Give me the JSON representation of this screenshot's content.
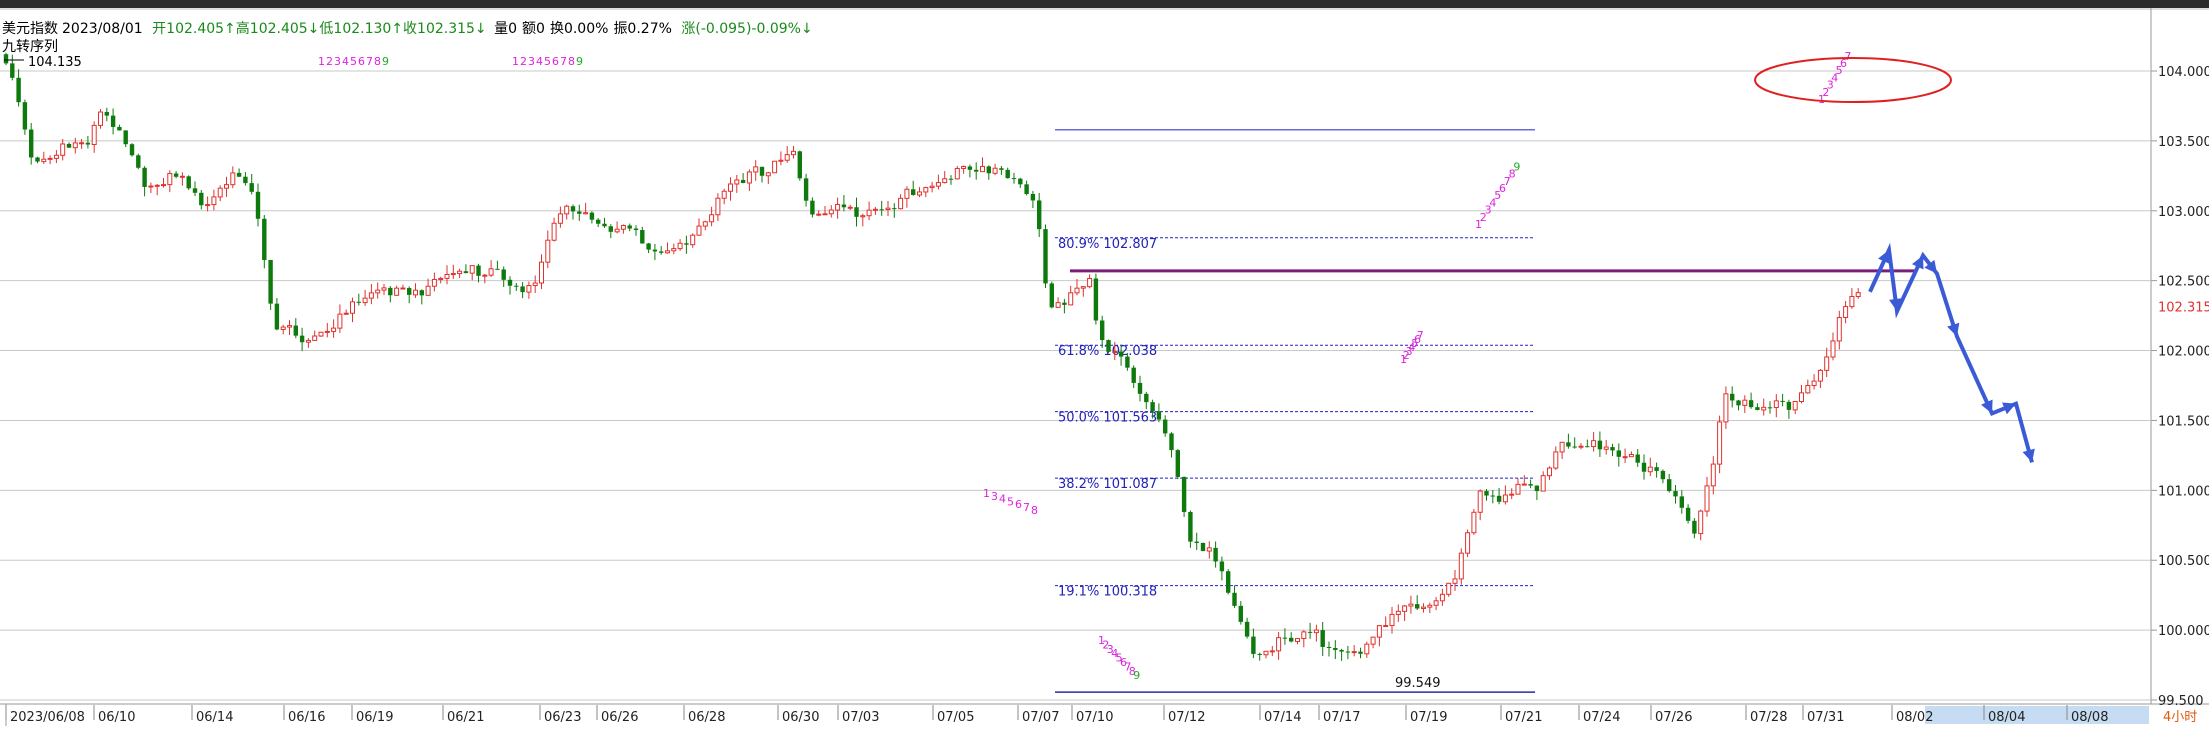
{
  "header": {
    "name": "美元指数",
    "date": "2023/08/01",
    "open": "开102.405↑",
    "high": "高102.405↓",
    "low": "低102.130↑",
    "close": "收102.315↓",
    "volume": "量0",
    "amount": "额0",
    "turnover": "换0.00%",
    "amplitude": "振0.27%",
    "change": "涨(-0.095)-0.09%↓"
  },
  "indicator": {
    "name": "九转序列",
    "max_value": "104.135"
  },
  "colors": {
    "up": "#e0322e",
    "down": "#0e7a0e",
    "fib": "#2222cc",
    "resistance": "#7a1e7a",
    "magenta": "#dd22dd",
    "green_num": "#22aa22",
    "arrow": "#3b5bd6",
    "ellipse": "#e02020",
    "grid": "#c8c8c8",
    "price_label": "#e0322e"
  },
  "chart_data": {
    "type": "candlestick",
    "title": "美元指数",
    "timeframe": "4小时",
    "ylim": [
      99.5,
      104.4
    ],
    "y_ticks": [
      "104.000",
      "103.500",
      "103.000",
      "102.500",
      "102.000",
      "101.500",
      "101.000",
      "100.500",
      "100.000",
      "99.500"
    ],
    "current_price": "102.315",
    "x_ticks": [
      "2023/06/08",
      "06/10",
      "06/14",
      "06/16",
      "06/19",
      "06/21",
      "06/23",
      "06/26",
      "06/28",
      "06/30",
      "07/03",
      "07/05",
      "07/07",
      "07/10",
      "07/12",
      "07/14",
      "07/17",
      "07/19",
      "07/21",
      "07/24",
      "07/26",
      "07/28",
      "07/31",
      "08/02",
      "08/04",
      "08/08"
    ],
    "fib_levels": [
      {
        "label": "80.9% 102.807",
        "value": 102.807
      },
      {
        "label": "61.8% 102.038",
        "value": 102.038
      },
      {
        "label": "50.0% 101.563",
        "value": 101.563
      },
      {
        "label": "38.2% 101.087",
        "value": 101.087
      },
      {
        "label": "19.1% 100.318",
        "value": 100.318
      }
    ],
    "swing_high": 103.58,
    "swing_low_label": "99.549",
    "swing_low": 99.549,
    "resistance_level": 102.57,
    "td_sequences": [
      "123456789",
      "123456789",
      "1345678",
      "123456789",
      "123456789",
      "1234567",
      "1234567"
    ],
    "projection": [
      [
        102.42,
        102.72
      ],
      [
        102.72,
        102.28
      ],
      [
        102.28,
        102.68
      ],
      [
        102.68,
        102.55
      ],
      [
        102.55,
        102.1
      ],
      [
        102.1,
        101.55
      ],
      [
        101.55,
        101.62
      ],
      [
        101.62,
        101.2
      ]
    ]
  }
}
